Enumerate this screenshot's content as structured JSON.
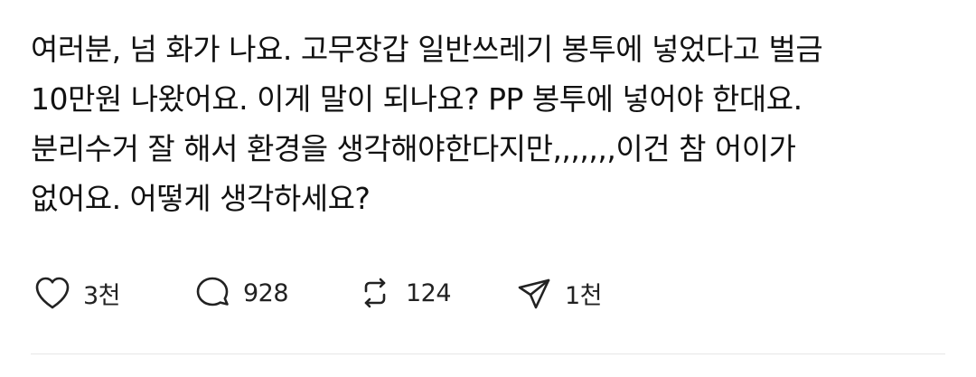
{
  "post": {
    "lines": [
      "여러분, 넘 화가 나요. 고무장갑 일반쓰레기 봉투에 넣었다고 벌금",
      "10만원 나왔어요. 이게 말이 되나요? PP 봉투에 넣어야 한대요.",
      "분리수거 잘 해서 환경을 생각해야한다지만,,,,,,,이건 참 어이가",
      "없어요. 어떻게 생각하세요?"
    ]
  },
  "actions": {
    "like": {
      "icon": "heart-icon",
      "count": "3천"
    },
    "reply": {
      "icon": "comment-bubble-icon",
      "count": "928"
    },
    "repost": {
      "icon": "repost-icon",
      "count": "124"
    },
    "share": {
      "icon": "send-icon",
      "count": "1천"
    }
  },
  "colors": {
    "text": "#111111",
    "icon": "#222222",
    "divider": "#e6e6e6",
    "background": "#ffffff"
  }
}
